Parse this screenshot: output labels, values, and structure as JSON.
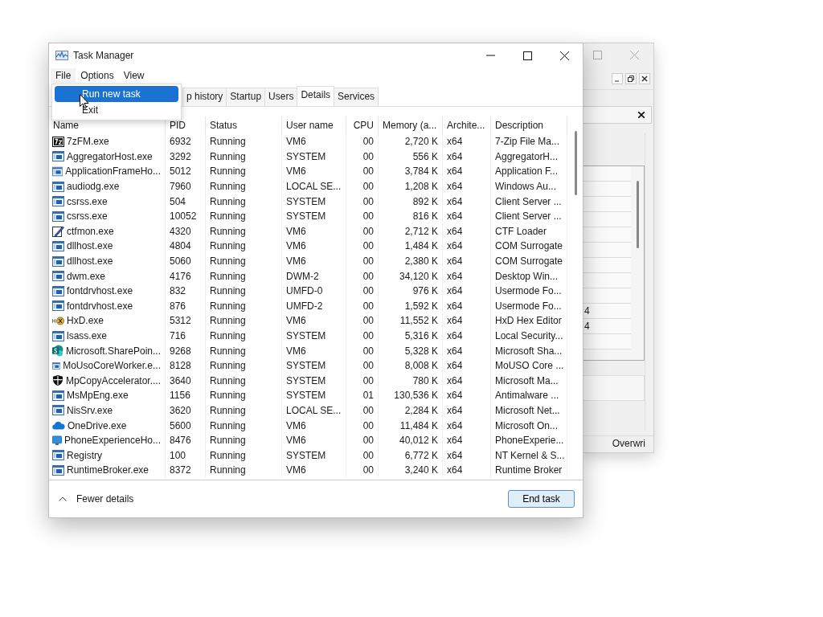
{
  "back_window": {
    "row_values": [
      "4",
      "4"
    ],
    "status_text": "Overwri"
  },
  "window": {
    "title": "Task Manager"
  },
  "menu_bar": [
    {
      "label": "File",
      "selected": true
    },
    {
      "label": "Options",
      "selected": false
    },
    {
      "label": "View",
      "selected": false
    }
  ],
  "file_menu": [
    {
      "label": "Run new task",
      "selected": true
    },
    {
      "label": "Exit",
      "selected": false
    }
  ],
  "tabs": [
    {
      "label": "p history",
      "selected": false
    },
    {
      "label": "Startup",
      "selected": false
    },
    {
      "label": "Users",
      "selected": false
    },
    {
      "label": "Details",
      "selected": true
    },
    {
      "label": "Services",
      "selected": false
    }
  ],
  "table": {
    "columns": [
      "Name",
      "PID",
      "Status",
      "User name",
      "CPU",
      "Memory (a...",
      "Archite...",
      "Description"
    ],
    "rows": [
      {
        "kind": "archiver",
        "cells": [
          "7zFM.exe",
          "6932",
          "Running",
          "VM6",
          "00",
          "2,720 K",
          "x64",
          "7-Zip File Ma..."
        ]
      },
      {
        "kind": "window",
        "cells": [
          "AggregatorHost.exe",
          "3292",
          "Running",
          "SYSTEM",
          "00",
          "556 K",
          "x64",
          "AggregatorH..."
        ]
      },
      {
        "kind": "window",
        "cells": [
          "ApplicationFrameHo...",
          "5012",
          "Running",
          "VM6",
          "00",
          "3,784 K",
          "x64",
          "Application F..."
        ]
      },
      {
        "kind": "window",
        "cells": [
          "audiodg.exe",
          "7960",
          "Running",
          "LOCAL SE...",
          "00",
          "1,208 K",
          "x64",
          "Windows Au..."
        ]
      },
      {
        "kind": "window",
        "cells": [
          "csrss.exe",
          "504",
          "Running",
          "SYSTEM",
          "00",
          "892 K",
          "x64",
          "Client Server ..."
        ]
      },
      {
        "kind": "window",
        "cells": [
          "csrss.exe",
          "10052",
          "Running",
          "SYSTEM",
          "00",
          "816 K",
          "x64",
          "Client Server ..."
        ]
      },
      {
        "kind": "pen",
        "cells": [
          "ctfmon.exe",
          "4320",
          "Running",
          "VM6",
          "00",
          "2,712 K",
          "x64",
          "CTF Loader"
        ]
      },
      {
        "kind": "window",
        "cells": [
          "dllhost.exe",
          "4804",
          "Running",
          "VM6",
          "00",
          "1,484 K",
          "x64",
          "COM Surrogate"
        ]
      },
      {
        "kind": "window",
        "cells": [
          "dllhost.exe",
          "5060",
          "Running",
          "VM6",
          "00",
          "2,380 K",
          "x64",
          "COM Surrogate"
        ]
      },
      {
        "kind": "window",
        "cells": [
          "dwm.exe",
          "4176",
          "Running",
          "DWM-2",
          "00",
          "34,120 K",
          "x64",
          "Desktop Win..."
        ]
      },
      {
        "kind": "window",
        "cells": [
          "fontdrvhost.exe",
          "832",
          "Running",
          "UMFD-0",
          "00",
          "976 K",
          "x64",
          "Usermode Fo..."
        ]
      },
      {
        "kind": "window",
        "cells": [
          "fontdrvhost.exe",
          "876",
          "Running",
          "UMFD-2",
          "00",
          "1,592 K",
          "x64",
          "Usermode Fo..."
        ]
      },
      {
        "kind": "hex",
        "cells": [
          "HxD.exe",
          "5312",
          "Running",
          "VM6",
          "00",
          "11,552 K",
          "x64",
          "HxD Hex Editor"
        ]
      },
      {
        "kind": "window",
        "cells": [
          "lsass.exe",
          "716",
          "Running",
          "SYSTEM",
          "00",
          "5,316 K",
          "x64",
          "Local Security..."
        ]
      },
      {
        "kind": "sharepoint",
        "cells": [
          "Microsoft.SharePoin...",
          "9268",
          "Running",
          "VM6",
          "00",
          "5,328 K",
          "x64",
          "Microsoft Sha..."
        ]
      },
      {
        "kind": "window",
        "cells": [
          "MoUsoCoreWorker.e...",
          "8128",
          "Running",
          "SYSTEM",
          "00",
          "8,008 K",
          "x64",
          "MoUSO Core ..."
        ]
      },
      {
        "kind": "shield",
        "cells": [
          "MpCopyAccelerator....",
          "3640",
          "Running",
          "SYSTEM",
          "00",
          "780 K",
          "x64",
          "Microsoft Ma..."
        ]
      },
      {
        "kind": "window",
        "cells": [
          "MsMpEng.exe",
          "1156",
          "Running",
          "SYSTEM",
          "01",
          "130,536 K",
          "x64",
          "Antimalware ..."
        ]
      },
      {
        "kind": "window",
        "cells": [
          "NisSrv.exe",
          "3620",
          "Running",
          "LOCAL SE...",
          "00",
          "2,284 K",
          "x64",
          "Microsoft Net..."
        ]
      },
      {
        "kind": "cloud",
        "cells": [
          "OneDrive.exe",
          "5600",
          "Running",
          "VM6",
          "00",
          "11,484 K",
          "x64",
          "Microsoft On..."
        ]
      },
      {
        "kind": "phone",
        "cells": [
          "PhoneExperienceHo...",
          "8476",
          "Running",
          "VM6",
          "00",
          "40,012 K",
          "x64",
          "PhoneExperie..."
        ]
      },
      {
        "kind": "window",
        "cells": [
          "Registry",
          "100",
          "Running",
          "SYSTEM",
          "00",
          "6,772 K",
          "x64",
          "NT Kernel & S..."
        ]
      },
      {
        "kind": "window",
        "cells": [
          "RuntimeBroker.exe",
          "8372",
          "Running",
          "VM6",
          "00",
          "3,240 K",
          "x64",
          "Runtime Broker"
        ]
      }
    ]
  },
  "footer": {
    "toggle": "Fewer details",
    "button": "End task"
  }
}
